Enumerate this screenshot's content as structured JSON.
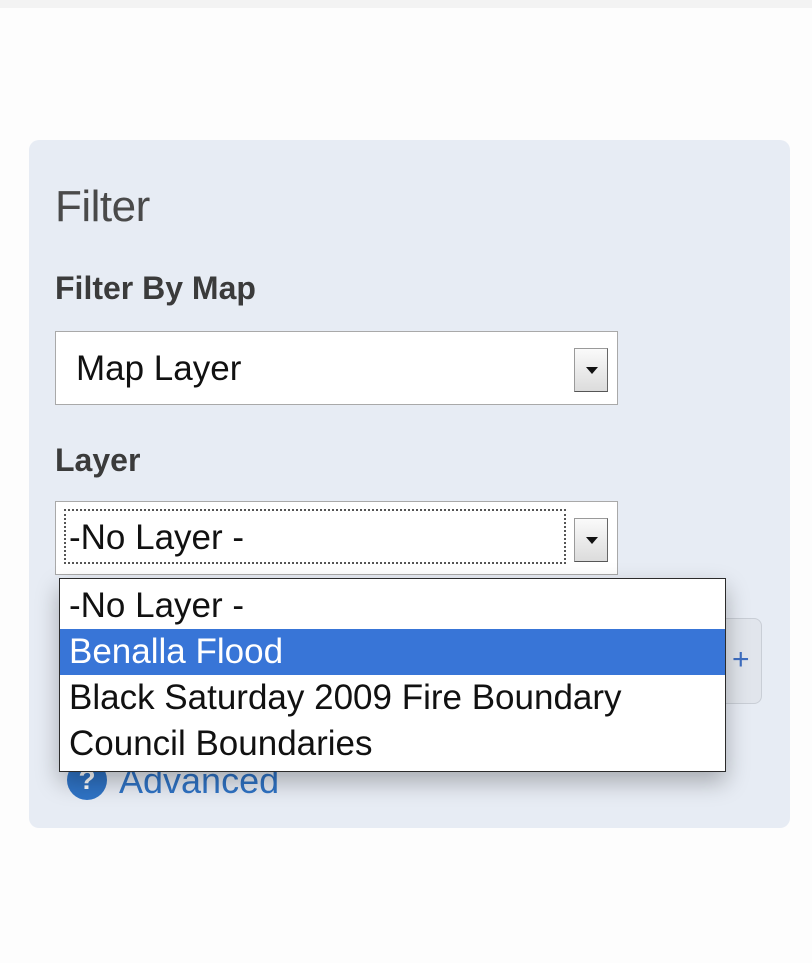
{
  "filter": {
    "title": "Filter",
    "filter_by_map_label": "Filter By Map",
    "filter_by_map_value": "Map Layer",
    "layer_label": "Layer",
    "layer_value": "-No Layer -"
  },
  "layer_dropdown": {
    "options": [
      {
        "label": "-No Layer -",
        "selected": false
      },
      {
        "label": "Benalla Flood",
        "selected": true
      },
      {
        "label": "Black Saturday 2009 Fire Boundary",
        "selected": false
      },
      {
        "label": "Council Boundaries",
        "selected": false
      }
    ],
    "highlight_color": "#3875d7"
  },
  "advanced": {
    "label": "Advanced",
    "icon": "expand-circle-icon"
  },
  "hidden_button": {
    "glyph": "+"
  },
  "colors": {
    "panel_background": "#e7ecf4",
    "link_blue": "#2f73c5"
  }
}
